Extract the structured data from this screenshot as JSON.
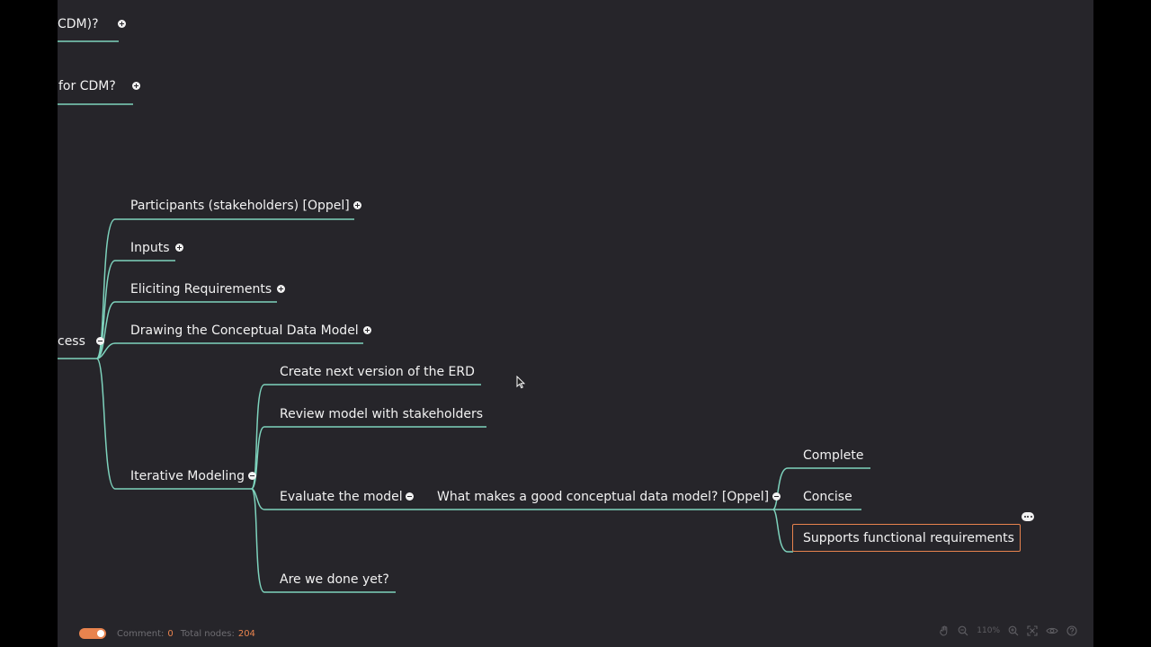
{
  "theme": {
    "background": "#26252a",
    "outside": "#000000",
    "branch_line": "#7ed3bd",
    "text": "#f2f2f2",
    "accent": "#e8834e",
    "muted": "#6e6d72"
  },
  "mindmap": {
    "partial_top_1": "CDM)?",
    "partial_top_2": "for CDM?",
    "root_partial": "cess",
    "branches": {
      "participants": "Participants (stakeholders) [Oppel]",
      "inputs": "Inputs",
      "eliciting": "Eliciting Requirements",
      "drawing": "Drawing the Conceptual Data Model",
      "iterative": "Iterative Modeling"
    },
    "iterative_children": {
      "create": "Create next version of the ERD",
      "review": "Review model with stakeholders",
      "evaluate": "Evaluate the model",
      "done": "Are we done yet?"
    },
    "evaluate_child": "What makes a good conceptual data model? [Oppel]",
    "qualities": {
      "complete": "Complete",
      "concise": "Concise",
      "supports": "Supports functional requirements"
    }
  },
  "footer": {
    "comment_label": "Comment:",
    "comment_count": "0",
    "total_nodes_label": "Total nodes:",
    "total_nodes_count": "204",
    "zoom_level": "110%",
    "icons": [
      "hand-icon",
      "zoom-out-icon",
      "zoom-in-icon",
      "fit-screen-icon",
      "eye-icon",
      "help-icon"
    ]
  }
}
